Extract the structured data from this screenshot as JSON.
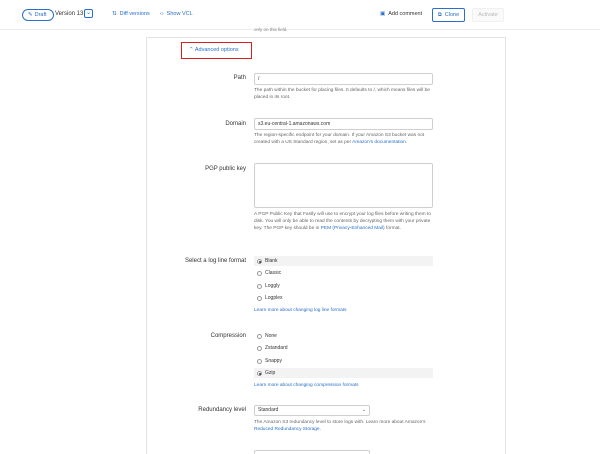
{
  "toolbar": {
    "draft_label": "Draft",
    "version_label": "Version 13",
    "diff_label": "Diff versions",
    "vcl_label": "Show VCL",
    "add_comment_label": "Add comment",
    "clone_label": "Clone",
    "activate_label": "Activate"
  },
  "top_fragment": "only on this field.",
  "advanced": {
    "label": "Advanced options"
  },
  "path": {
    "label": "Path",
    "value": "/",
    "help": "The path within the bucket for placing files. It defaults to /, which means files will be placed in its root."
  },
  "domain": {
    "label": "Domain",
    "value": "s3.eu-central-1.amazonaws.com",
    "help_prefix": "The region-specific endpoint for your domain. If your Amazon S3 bucket was not created with a US Standard region, set as per ",
    "help_link": "Amazon's documentation",
    "help_suffix": "."
  },
  "pgp": {
    "label": "PGP public key",
    "help_prefix": "A PGP Public Key that Fastly will use to encrypt your log files before writing them to disk. You will only be able to read the contents by decrypting them with your private key. The PGP key should be in ",
    "help_link": "PEM (Privacy-Enhanced Mail)",
    "help_suffix": " format."
  },
  "log_format": {
    "label": "Select a log line format",
    "options": [
      "Blank",
      "Classic",
      "Loggly",
      "Logplex"
    ],
    "selected": "Blank",
    "link": "Learn more about changing log line formats"
  },
  "compression": {
    "label": "Compression",
    "options": [
      "None",
      "Zstandard",
      "Snappy",
      "Gzip"
    ],
    "selected": "Gzip",
    "link": "Learn more about changing compression formats"
  },
  "redundancy": {
    "label": "Redundancy level",
    "value": "Standard",
    "help_prefix": "The Amazon S3 redundancy level to store logs with. Learn more about Amazon's ",
    "help_link": "Reduced Redundancy Storage",
    "help_suffix": "."
  }
}
